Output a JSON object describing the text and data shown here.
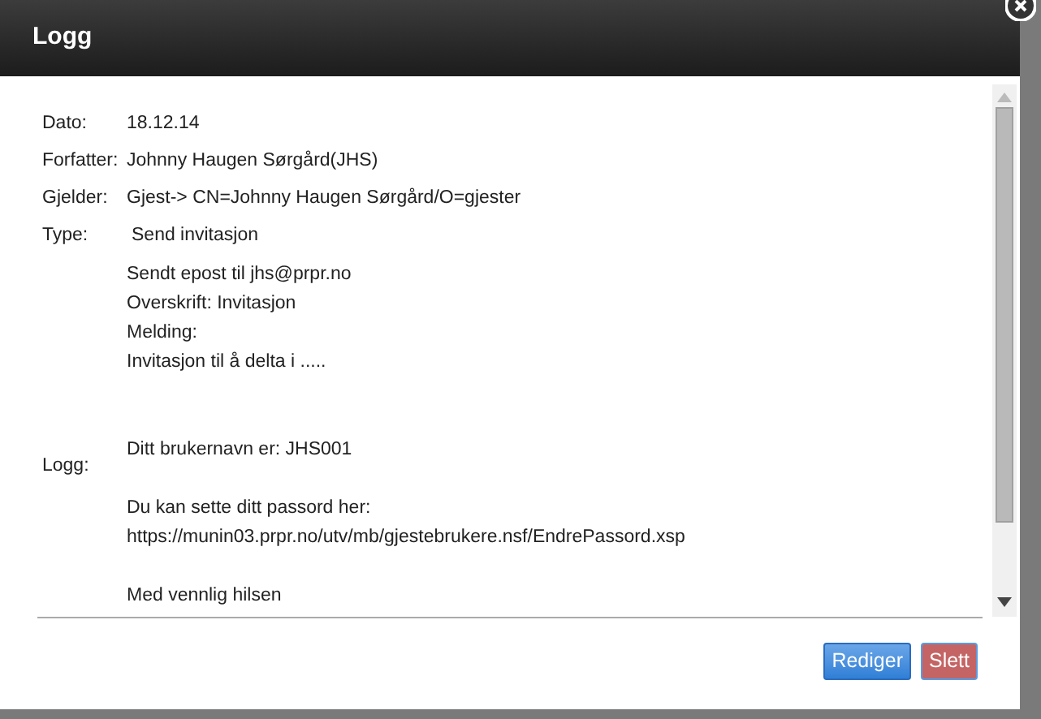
{
  "dialog": {
    "title": "Logg"
  },
  "fields": [
    {
      "label": "Dato:",
      "value": "18.12.14"
    },
    {
      "label": "Forfatter:",
      "value": "Johnny Haugen Sørgård(JHS)"
    },
    {
      "label": "Gjelder:",
      "value": "Gjest-> CN=Johnny Haugen Sørgård/O=gjester"
    },
    {
      "label": "Type:",
      "value": "Send invitasjon"
    }
  ],
  "message": [
    "Sendt epost til jhs@prpr.no",
    "Overskrift: Invitasjon",
    "Melding:",
    "Invitasjon til å delta i ....."
  ],
  "log": {
    "label": "Logg:",
    "paragraphs": [
      [
        "Ditt brukernavn er: JHS001"
      ],
      [
        "Du kan sette ditt passord her:",
        "https://munin03.prpr.no/utv/mb/gjestebrukere.nsf/EndrePassord.xsp"
      ],
      [
        "Med vennlig hilsen"
      ]
    ]
  },
  "buttons": [
    {
      "label": "Rediger",
      "kind": "primary"
    },
    {
      "label": "Slett",
      "kind": "danger"
    }
  ]
}
